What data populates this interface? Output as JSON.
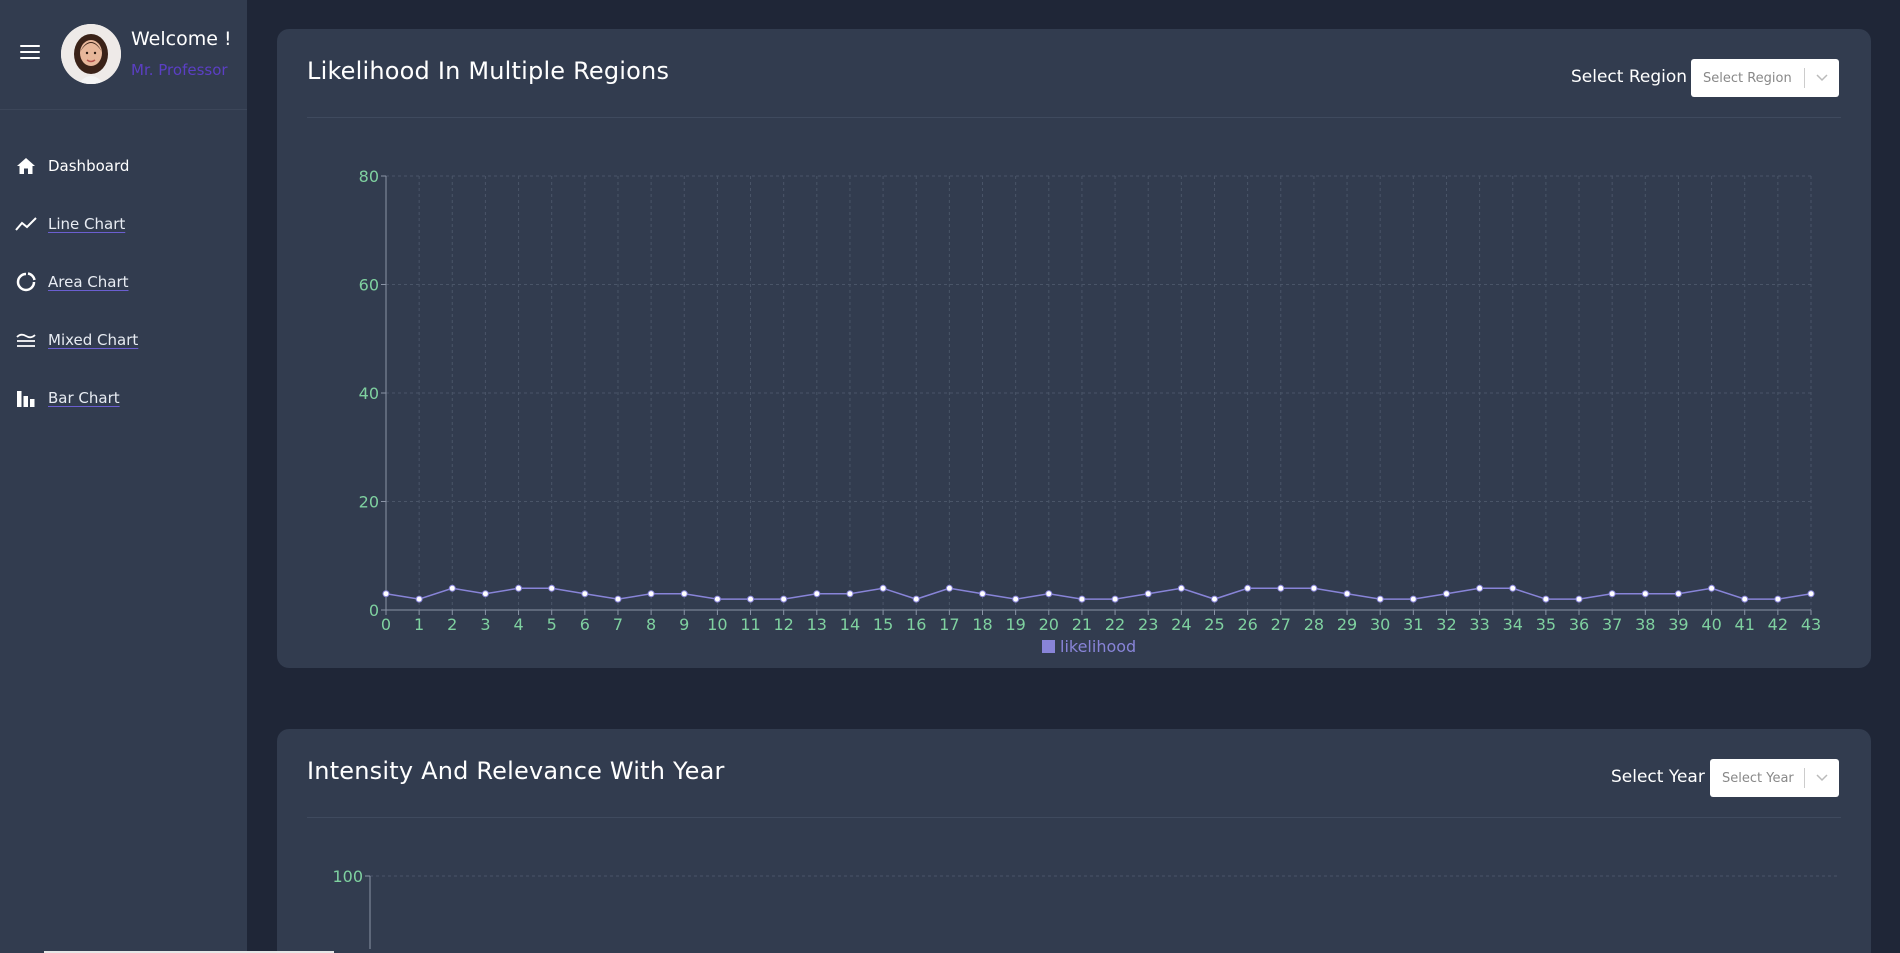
{
  "sidebar": {
    "welcome": "Welcome !",
    "user": "Mr. Professor",
    "items": [
      {
        "label": "Dashboard",
        "icon": "home-icon",
        "active": true
      },
      {
        "label": "Line Chart",
        "icon": "line-chart-icon"
      },
      {
        "label": "Area Chart",
        "icon": "area-chart-icon"
      },
      {
        "label": "Mixed Chart",
        "icon": "mixed-chart-icon"
      },
      {
        "label": "Bar Chart",
        "icon": "bar-chart-icon"
      }
    ]
  },
  "card1": {
    "title": "Likelihood In Multiple Regions",
    "select_label": "Select Region",
    "select_placeholder": "Select Region"
  },
  "card2": {
    "title": "Intensity And Relevance With Year",
    "select_label": "Select Year",
    "select_placeholder": "Select Year"
  },
  "colors": {
    "background": "#1f2637",
    "card": "#323c4f",
    "axis_text": "#7fd1a0",
    "series": "#8884d8",
    "accent_user": "#5b3fc4"
  },
  "chart_data": [
    {
      "type": "line",
      "title": "",
      "x": [
        0,
        1,
        2,
        3,
        4,
        5,
        6,
        7,
        8,
        9,
        10,
        11,
        12,
        13,
        14,
        15,
        16,
        17,
        18,
        19,
        20,
        21,
        22,
        23,
        24,
        25,
        26,
        27,
        28,
        29,
        30,
        31,
        32,
        33,
        34,
        35,
        36,
        37,
        38,
        39,
        40,
        41,
        42,
        43
      ],
      "series": [
        {
          "name": "likelihood",
          "values": [
            3,
            2,
            4,
            3,
            4,
            4,
            3,
            2,
            3,
            3,
            2,
            2,
            2,
            3,
            3,
            4,
            2,
            4,
            3,
            2,
            3,
            2,
            2,
            3,
            4,
            2,
            4,
            4,
            4,
            3,
            2,
            2,
            3,
            4,
            4,
            2,
            2,
            3,
            3,
            3,
            4,
            2,
            2,
            3
          ]
        }
      ],
      "ylim": [
        0,
        80
      ],
      "yticks": [
        0,
        20,
        40,
        60,
        80
      ],
      "grid": true,
      "legend": "bottom-center"
    },
    {
      "type": "bar",
      "ylim": [
        0,
        100
      ],
      "yticks": [
        100
      ],
      "grid": true
    }
  ]
}
